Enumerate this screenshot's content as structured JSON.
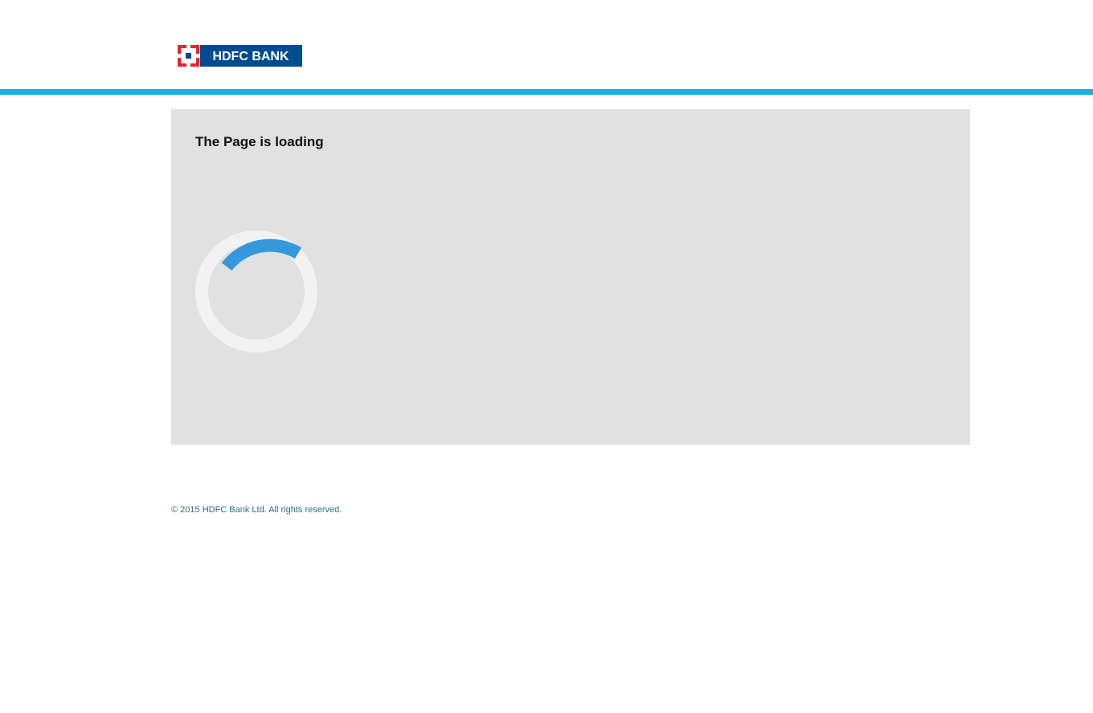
{
  "header": {
    "logo": {
      "text": "HDFC BANK",
      "icon": "hdfc-bank-logo-icon",
      "colors": {
        "brand_blue": "#004c8f",
        "brand_red": "#ed232a"
      }
    },
    "bar_color": "#1aafe2"
  },
  "main": {
    "title": "The Page is loading",
    "spinner": {
      "icon": "loading-spinner-icon",
      "track_color": "#f2f2f2",
      "arc_color": "#3598dc"
    },
    "background_color": "#e1e1e1"
  },
  "footer": {
    "copyright": "© 2015 HDFC Bank Ltd. All rights reserved."
  }
}
